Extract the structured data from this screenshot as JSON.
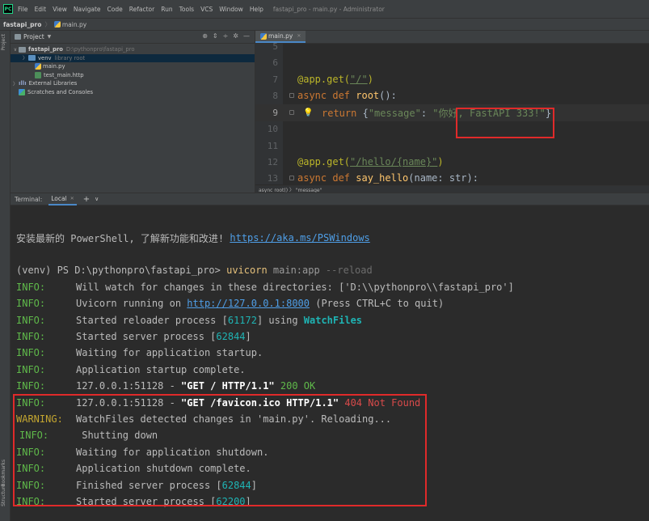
{
  "menubar": {
    "logo": "PC",
    "items": [
      "File",
      "Edit",
      "View",
      "Navigate",
      "Code",
      "Refactor",
      "Run",
      "Tools",
      "VCS",
      "Window",
      "Help"
    ],
    "window_title": "fastapi_pro - main.py - Administrator"
  },
  "navbar": {
    "project": "fastapi_pro",
    "file": "main.py"
  },
  "side_tabs": {
    "project": "Project",
    "bookmarks": "Bookmarks",
    "structure": "Structure"
  },
  "project_panel": {
    "title": "Project",
    "tree": [
      {
        "name": "fastapi_pro",
        "hint": "D:\\pythonpro\\fastapi_pro"
      },
      {
        "name": "venv",
        "hint": "library root"
      },
      {
        "name": "main.py"
      },
      {
        "name": "test_main.http"
      },
      {
        "name": "External Libraries"
      },
      {
        "name": "Scratches and Consoles"
      }
    ]
  },
  "editor": {
    "tab": "main.py",
    "breadcrumb": "async root() 〉 \"message\"",
    "lines": {
      "l5": "5",
      "l6": "6",
      "l7": "7",
      "l8": "8",
      "l9": "9",
      "l10": "10",
      "l11": "11",
      "l12": "12",
      "l13": "13"
    },
    "code": {
      "l7_dec": "@app.get(",
      "l7_str": "\"/\"",
      "l7_end": ")",
      "l8_kw": "async def ",
      "l8_fn": "root",
      "l8_end": "():",
      "l9_kw": "return ",
      "l9_p1": "{",
      "l9_key": "\"message\"",
      "l9_colon": ": ",
      "l9_val": "\"你好, FastAPI 333!\"",
      "l9_end": "}",
      "l12_dec": "@app.get(",
      "l12_str": "\"/hello/{name}\"",
      "l12_end": ")",
      "l13_kw": "async def ",
      "l13_fn": "say_hello",
      "l13_end": "(name: str):"
    }
  },
  "terminal": {
    "label": "Terminal:",
    "tab": "Local",
    "lines": {
      "ps_text": "安装最新的 PowerShell, 了解新功能和改进! ",
      "ps_link": "https://aka.ms/PSWindows",
      "prompt": "(venv) PS D:\\pythonpro\\fastapi_pro> ",
      "cmd": "uvicorn",
      "cmd_args": " main:app ",
      "cmd_flag": "--reload",
      "info": "INFO:",
      "warning": "WARNING:",
      "l1": "Will watch for changes in these directories: ['D:\\\\pythonpro\\\\fastapi_pro']",
      "l2_a": "Uvicorn running on ",
      "l2_link": "http://127.0.0.1:8000",
      "l2_b": " (Press CTRL+C to quit)",
      "l3_a": "Started reloader process [",
      "l3_pid": "61172",
      "l3_b": "] using ",
      "l3_c": "WatchFiles",
      "l4_a": "Started server process [",
      "l4_pid": "62844",
      "l4_b": "]",
      "l5": "Waiting for application startup.",
      "l6": "Application startup complete.",
      "l7_a": "127.0.0.1:51128 - ",
      "l7_b": "\"GET / HTTP/1.1\"",
      "l7_c": " 200 OK",
      "l8_a": "127.0.0.1:51128 - ",
      "l8_b": "\"GET /favicon.ico HTTP/1.1\"",
      "l8_c": " 404 Not Found",
      "l9": "WatchFiles detected changes in 'main.py'. Reloading...",
      "l10": " Shutting down",
      "l11": "Waiting for application shutdown.",
      "l12": "Application shutdown complete.",
      "l13_a": "Finished server process [",
      "l13_pid": "62844",
      "l13_b": "]",
      "l14_a": "Started server process [",
      "l14_pid": "62200",
      "l14_b": "]"
    }
  }
}
